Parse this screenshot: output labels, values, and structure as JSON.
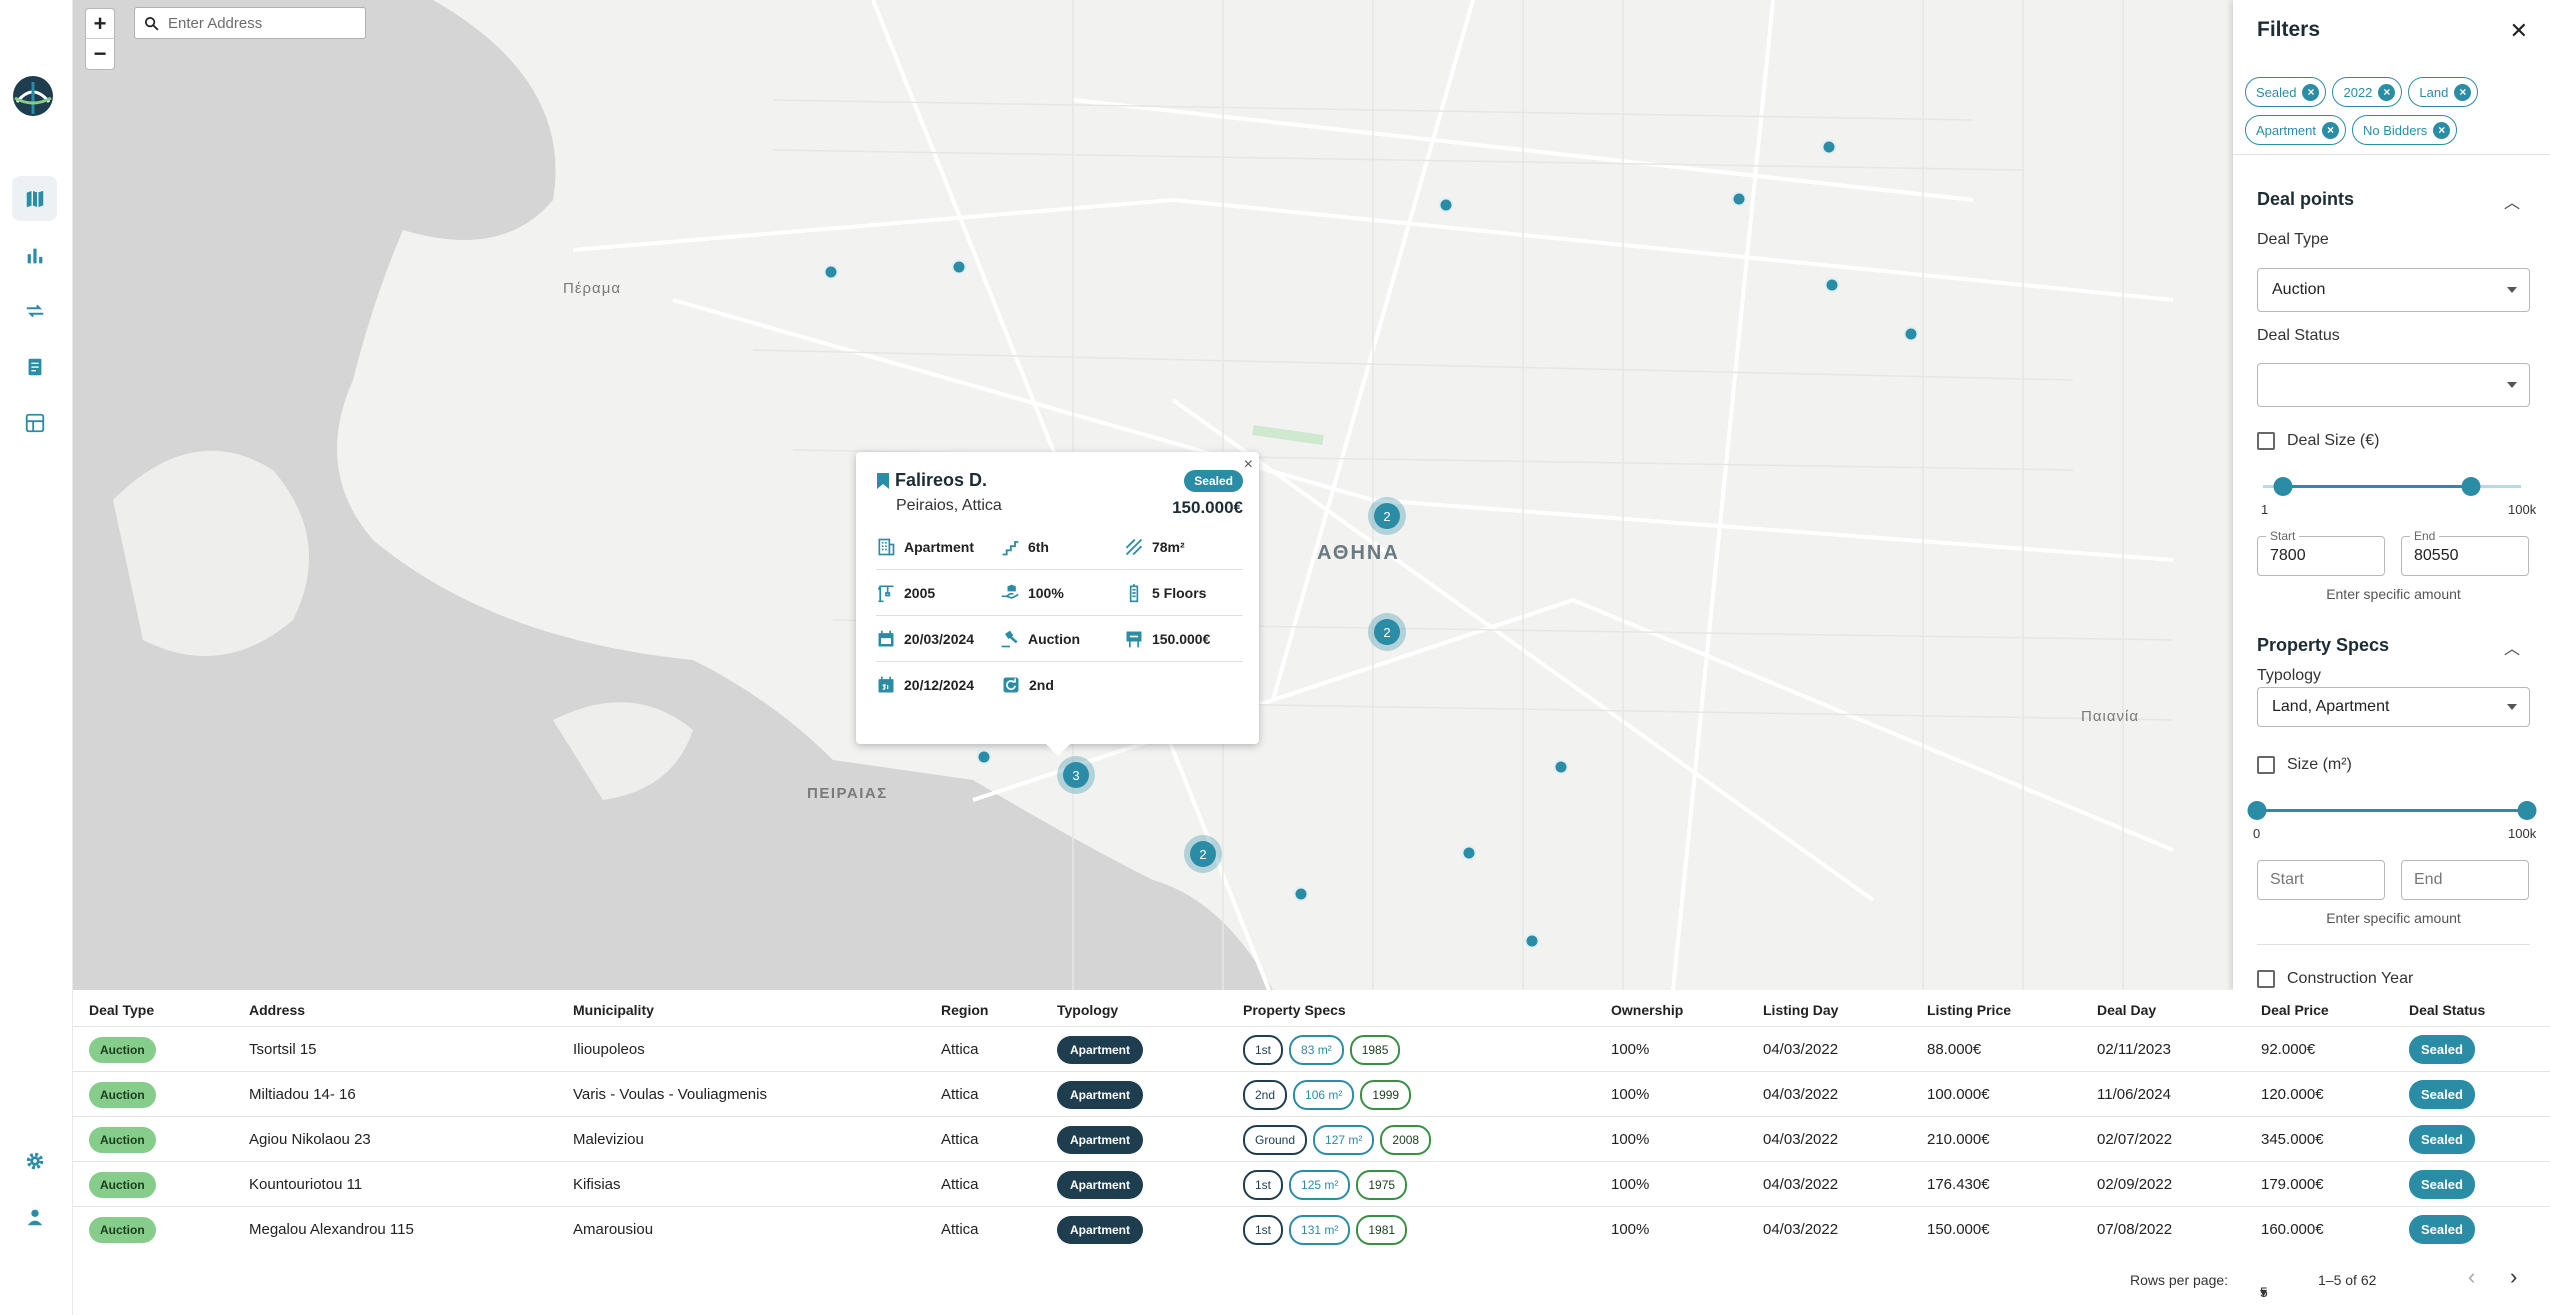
{
  "map": {
    "search_placeholder": "Enter Address",
    "zoom_in": "+",
    "zoom_out": "−",
    "labels": {
      "athens": "ΑΘΗΝΑ",
      "piraeus": "ΠΕΙΡΑΙΑΣ",
      "paiania": "Παιανία",
      "perama": "Πέραμα"
    },
    "clusters": [
      "2",
      "2",
      "3",
      "2"
    ]
  },
  "popup": {
    "close": "×",
    "title": "Falireos D.",
    "subtitle": "Peiraios, Attica",
    "status": "Sealed",
    "price": "150.000€",
    "details": {
      "typology": "Apartment",
      "floor": "6th",
      "size": "78m²",
      "year": "2005",
      "ownership": "100%",
      "floors": "5 Floors",
      "listing_date": "20/03/2024",
      "deal_type": "Auction",
      "listing_price": "150.000€",
      "deal_date": "20/12/2024",
      "round": "2nd"
    }
  },
  "filters": {
    "title": "Filters",
    "close": "✕",
    "chips": [
      "Sealed",
      "2022",
      "Land",
      "Apartment",
      "No Bidders"
    ],
    "deal_points": {
      "title": "Deal points",
      "deal_type_label": "Deal Type",
      "deal_type_value": "Auction",
      "deal_status_label": "Deal Status",
      "deal_status_value": "",
      "deal_size_label": "Deal Size (€)",
      "slider_min": "1",
      "slider_max": "100k",
      "range_low": 0.078,
      "range_high": 0.8055,
      "start_label": "Start",
      "start_value": "7800",
      "end_label": "End",
      "end_value": "80550",
      "hint": "Enter specific amount"
    },
    "property_specs": {
      "title": "Property Specs",
      "typology_label": "Typology",
      "typology_value": "Land, Apartment",
      "size_label": "Size (m²)",
      "slider_min": "0",
      "slider_max": "100k",
      "range_low": 0,
      "range_high": 1,
      "start_placeholder": "Start",
      "end_placeholder": "End",
      "hint": "Enter specific amount",
      "construction_label": "Construction Year"
    }
  },
  "table": {
    "headers": [
      "Deal Type",
      "Address",
      "Municipality",
      "Region",
      "Typology",
      "Property Specs",
      "Ownership",
      "Listing Day",
      "Listing Price",
      "Deal Day",
      "Deal Price",
      "Deal Status"
    ],
    "rows": [
      {
        "deal_type": "Auction",
        "address": "Tsortsil 15",
        "municipality": "Ilioupoleos",
        "region": "Attica",
        "typology": "Apartment",
        "specs": [
          "1st",
          "83 m²",
          "1985"
        ],
        "ownership": "100%",
        "listing_day": "04/03/2022",
        "listing_price": "88.000€",
        "deal_day": "02/11/2023",
        "deal_price": "92.000€",
        "status": "Sealed"
      },
      {
        "deal_type": "Auction",
        "address": "Miltiadou 14- 16",
        "municipality": "Varis - Voulas - Vouliagmenis",
        "region": "Attica",
        "typology": "Apartment",
        "specs": [
          "2nd",
          "106 m²",
          "1999"
        ],
        "ownership": "100%",
        "listing_day": "04/03/2022",
        "listing_price": "100.000€",
        "deal_day": "11/06/2024",
        "deal_price": "120.000€",
        "status": "Sealed"
      },
      {
        "deal_type": "Auction",
        "address": "Agiou Nikolaou 23",
        "municipality": "Maleviziou",
        "region": "Attica",
        "typology": "Apartment",
        "specs": [
          "Ground",
          "127 m²",
          "2008"
        ],
        "ownership": "100%",
        "listing_day": "04/03/2022",
        "listing_price": "210.000€",
        "deal_day": "02/07/2022",
        "deal_price": "345.000€",
        "status": "Sealed"
      },
      {
        "deal_type": "Auction",
        "address": "Kountouriotou 11",
        "municipality": "Kifisias",
        "region": "Attica",
        "typology": "Apartment",
        "specs": [
          "1st",
          "125 m²",
          "1975"
        ],
        "ownership": "100%",
        "listing_day": "04/03/2022",
        "listing_price": "176.430€",
        "deal_day": "02/09/2022",
        "deal_price": "179.000€",
        "status": "Sealed"
      },
      {
        "deal_type": "Auction",
        "address": "Megalou Alexandrou 115",
        "municipality": "Amarousiou",
        "region": "Attica",
        "typology": "Apartment",
        "specs": [
          "1st",
          "131 m²",
          "1981"
        ],
        "ownership": "100%",
        "listing_day": "04/03/2022",
        "listing_price": "150.000€",
        "deal_day": "07/08/2022",
        "deal_price": "160.000€",
        "status": "Sealed"
      }
    ],
    "pagination": {
      "rows_per_page_label": "Rows per page:",
      "rows_per_page": "5",
      "range": "1–5 of 62",
      "prev": "‹",
      "next": "›"
    }
  },
  "colors": {
    "accent": "#2b8ca6",
    "dark": "#1e3d4f",
    "green": "#86cc8b"
  }
}
